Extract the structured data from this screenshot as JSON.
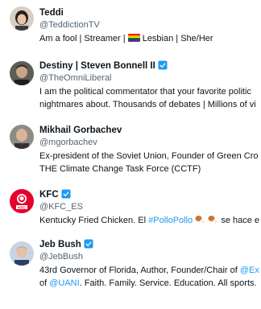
{
  "accounts": [
    {
      "name": "Teddi",
      "verified": false,
      "handle": "@TeddictionTV",
      "bio": {
        "part1": "Am a fool | Streamer | ",
        "flag_icon": "rainbow-flag-icon",
        "part2": " Lesbian | She/Her"
      }
    },
    {
      "name": "Destiny | Steven Bonnell II",
      "verified": true,
      "handle": "@TheOmniLiberal",
      "bio": {
        "line1": "I am the political commentator that your favorite politic",
        "line2": "nightmares about. Thousands of debates | Millions of vi"
      }
    },
    {
      "name": "Mikhail Gorbachev",
      "verified": false,
      "handle": "@mgorbachev",
      "bio": {
        "line1": "Ex-president of the Soviet Union, Founder of Green Cro",
        "line2": "THE Climate Change Task Force (CCTF)"
      }
    },
    {
      "name": "KFC",
      "verified": true,
      "handle": "@KFC_ES",
      "bio": {
        "text1": "Kentucky Fried Chicken. El ",
        "hashtag": "#PolloPollo",
        "emoji_icon": "drumstick-icon",
        "text2": " se hace e"
      }
    },
    {
      "name": "Jeb Bush",
      "verified": true,
      "handle": "@JebBush",
      "bio": {
        "line1_text": "43rd Governor of Florida, Author, Founder/Chair of ",
        "line1_link": "@Ex",
        "line2_pre": "of ",
        "line2_link": "@UANI",
        "line2_text": ". Faith. Family. Service. Education. All sports. "
      }
    }
  ],
  "colors": {
    "text": "#0f1419",
    "secondary": "#536471",
    "link": "#1d9bf0",
    "verified": "#1d9bf0"
  }
}
